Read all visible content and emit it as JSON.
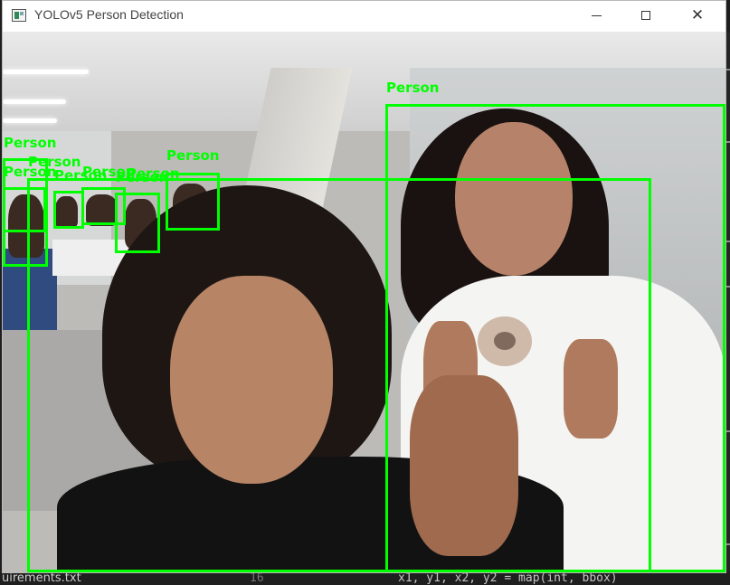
{
  "window": {
    "title": "YOLOv5 Person Detection",
    "controls": {
      "minimize_icon": "minimize-icon",
      "maximize_icon": "maximize-icon",
      "close_icon": "close-icon",
      "close_glyph": "✕"
    }
  },
  "video": {
    "detection_color": "#00ff00",
    "detections": [
      {
        "label": "Person"
      },
      {
        "label": "Person"
      },
      {
        "label": "Person"
      },
      {
        "label": "Person"
      },
      {
        "label": "Person"
      },
      {
        "label": "Person"
      },
      {
        "label": "Person"
      },
      {
        "label": "Person"
      },
      {
        "label": "Person"
      }
    ]
  },
  "background_editor": {
    "filename_fragment": "uirements.txt",
    "line_number": "16",
    "code_fragment": "x1, y1, x2, y2 = map(int, bbox)"
  }
}
